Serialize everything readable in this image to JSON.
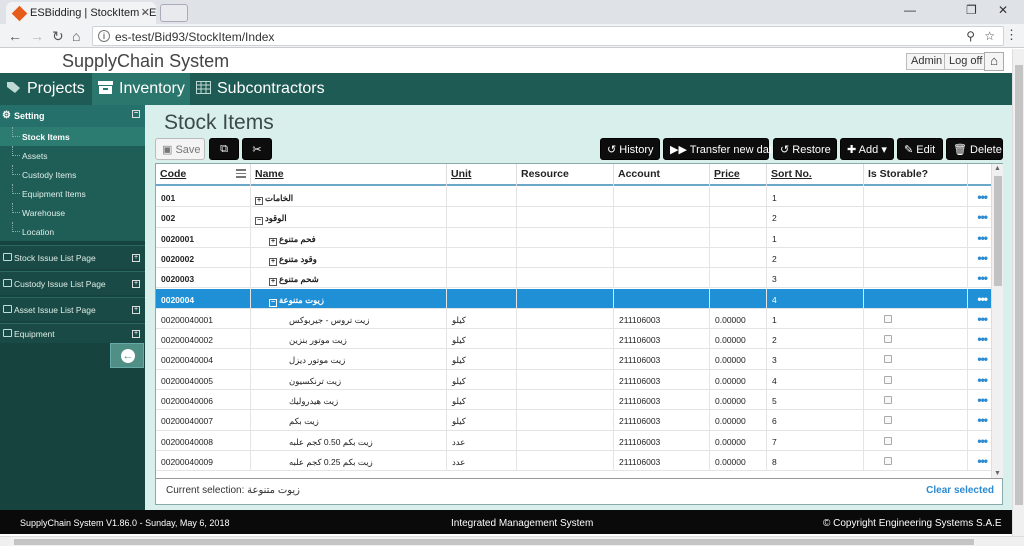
{
  "browser": {
    "tab_title": "ESBidding | StockItem - E",
    "url": "es-test/Bid93/StockItem/Index"
  },
  "app": {
    "name": "SupplyChain System",
    "admin_label": "Admin",
    "logoff_label": "Log off"
  },
  "mainnav": [
    {
      "label": "Projects"
    },
    {
      "label": "Inventory"
    },
    {
      "label": "Subcontractors"
    }
  ],
  "sidebar": {
    "setting_label": "Setting",
    "sub_items": [
      {
        "label": "Stock Items"
      },
      {
        "label": "Assets"
      },
      {
        "label": "Custody Items"
      },
      {
        "label": "Equipment Items"
      },
      {
        "label": "Warehouse"
      },
      {
        "label": "Location"
      }
    ],
    "groups": [
      {
        "label": "Stock Issue List Page"
      },
      {
        "label": "Custody Issue List Page"
      },
      {
        "label": "Asset Issue List Page"
      },
      {
        "label": "Equipment"
      }
    ]
  },
  "page": {
    "title": "Stock Items",
    "save_label": "Save",
    "history_label": "History",
    "transfer_label": "Transfer new data",
    "restore_label": "Restore",
    "add_label": "Add",
    "edit_label": "Edit",
    "delete_label": "Delete"
  },
  "grid": {
    "columns": [
      "Code",
      "Name",
      "Unit",
      "Resource",
      "Account",
      "Price",
      "Sort No.",
      "Is Storable?"
    ],
    "rows": [
      {
        "code": "001",
        "name": "الخامات",
        "unit": "",
        "resource": "",
        "account": "",
        "price": "",
        "sort": "1",
        "expander": "+",
        "indent": 0,
        "check": false
      },
      {
        "code": "002",
        "name": "الوقود",
        "unit": "",
        "resource": "",
        "account": "",
        "price": "",
        "sort": "2",
        "expander": "−",
        "indent": 0,
        "check": false
      },
      {
        "code": "0020001",
        "name": "فحم متنوع",
        "unit": "",
        "resource": "",
        "account": "",
        "price": "",
        "sort": "1",
        "expander": "+",
        "indent": 1,
        "check": false
      },
      {
        "code": "0020002",
        "name": "وقود متنوع",
        "unit": "",
        "resource": "",
        "account": "",
        "price": "",
        "sort": "2",
        "expander": "+",
        "indent": 1,
        "check": false
      },
      {
        "code": "0020003",
        "name": "شحم متنوع",
        "unit": "",
        "resource": "",
        "account": "",
        "price": "",
        "sort": "3",
        "expander": "+",
        "indent": 1,
        "check": false
      },
      {
        "code": "0020004",
        "name": "زيوت متنوعة",
        "unit": "",
        "resource": "",
        "account": "",
        "price": "",
        "sort": "4",
        "expander": "−",
        "indent": 1,
        "check": false,
        "selected": true
      },
      {
        "code": "00200040001",
        "name": "زيت تروس - جيربوكس",
        "unit": "كيلو",
        "resource": "",
        "account": "211106003",
        "price": "0.00000",
        "sort": "1",
        "expander": "",
        "indent": 2,
        "check": true
      },
      {
        "code": "00200040002",
        "name": "زيت موتور بنزين",
        "unit": "كيلو",
        "resource": "",
        "account": "211106003",
        "price": "0.00000",
        "sort": "2",
        "expander": "",
        "indent": 2,
        "check": true
      },
      {
        "code": "00200040004",
        "name": "زيت موتور ديزل",
        "unit": "كيلو",
        "resource": "",
        "account": "211106003",
        "price": "0.00000",
        "sort": "3",
        "expander": "",
        "indent": 2,
        "check": true
      },
      {
        "code": "00200040005",
        "name": "زيت ترنكسيون",
        "unit": "كيلو",
        "resource": "",
        "account": "211106003",
        "price": "0.00000",
        "sort": "4",
        "expander": "",
        "indent": 2,
        "check": true
      },
      {
        "code": "00200040006",
        "name": "زيت هيدروليك",
        "unit": "كيلو",
        "resource": "",
        "account": "211106003",
        "price": "0.00000",
        "sort": "5",
        "expander": "",
        "indent": 2,
        "check": true
      },
      {
        "code": "00200040007",
        "name": "زيت بكم",
        "unit": "كيلو",
        "resource": "",
        "account": "211106003",
        "price": "0.00000",
        "sort": "6",
        "expander": "",
        "indent": 2,
        "check": true
      },
      {
        "code": "00200040008",
        "name": "زيت بكم 0.50 كجم علبه",
        "unit": "عدد",
        "resource": "",
        "account": "211106003",
        "price": "0.00000",
        "sort": "7",
        "expander": "",
        "indent": 2,
        "check": true
      },
      {
        "code": "00200040009",
        "name": "زيت بكم 0.25 كجم علبه",
        "unit": "عدد",
        "resource": "",
        "account": "211106003",
        "price": "0.00000",
        "sort": "8",
        "expander": "",
        "indent": 2,
        "check": true
      }
    ],
    "current_selection_label": "Current selection:",
    "current_selection_value": "زيوت متنوعة",
    "clear_selected_label": "Clear selected"
  },
  "footer": {
    "version": "SupplyChain System V1.86.0 - Sunday, May 6, 2018",
    "center": "Integrated Management System",
    "copyright": "© Copyright Engineering Systems S.A.E"
  }
}
